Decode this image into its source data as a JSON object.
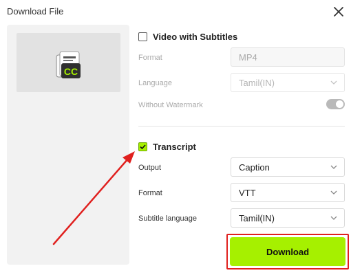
{
  "dialog": {
    "title": "Download File"
  },
  "video_section": {
    "checkbox_label": "Video with Subtitles",
    "checked": false,
    "format_label": "Format",
    "format_value": "MP4",
    "language_label": "Language",
    "language_value": "Tamil(IN)",
    "watermark_label": "Without Watermark",
    "watermark_on": true
  },
  "transcript_section": {
    "checkbox_label": "Transcript",
    "checked": true,
    "output_label": "Output",
    "output_value": "Caption",
    "format_label": "Format",
    "format_value": "VTT",
    "subtitle_language_label": "Subtitle language",
    "subtitle_language_value": "Tamil(IN)"
  },
  "preview": {
    "icon": "cc-subtitle-icon",
    "icon_text": "CC"
  },
  "actions": {
    "download_label": "Download"
  },
  "colors": {
    "accent": "#a6f000",
    "annotation": "#e0201e"
  }
}
